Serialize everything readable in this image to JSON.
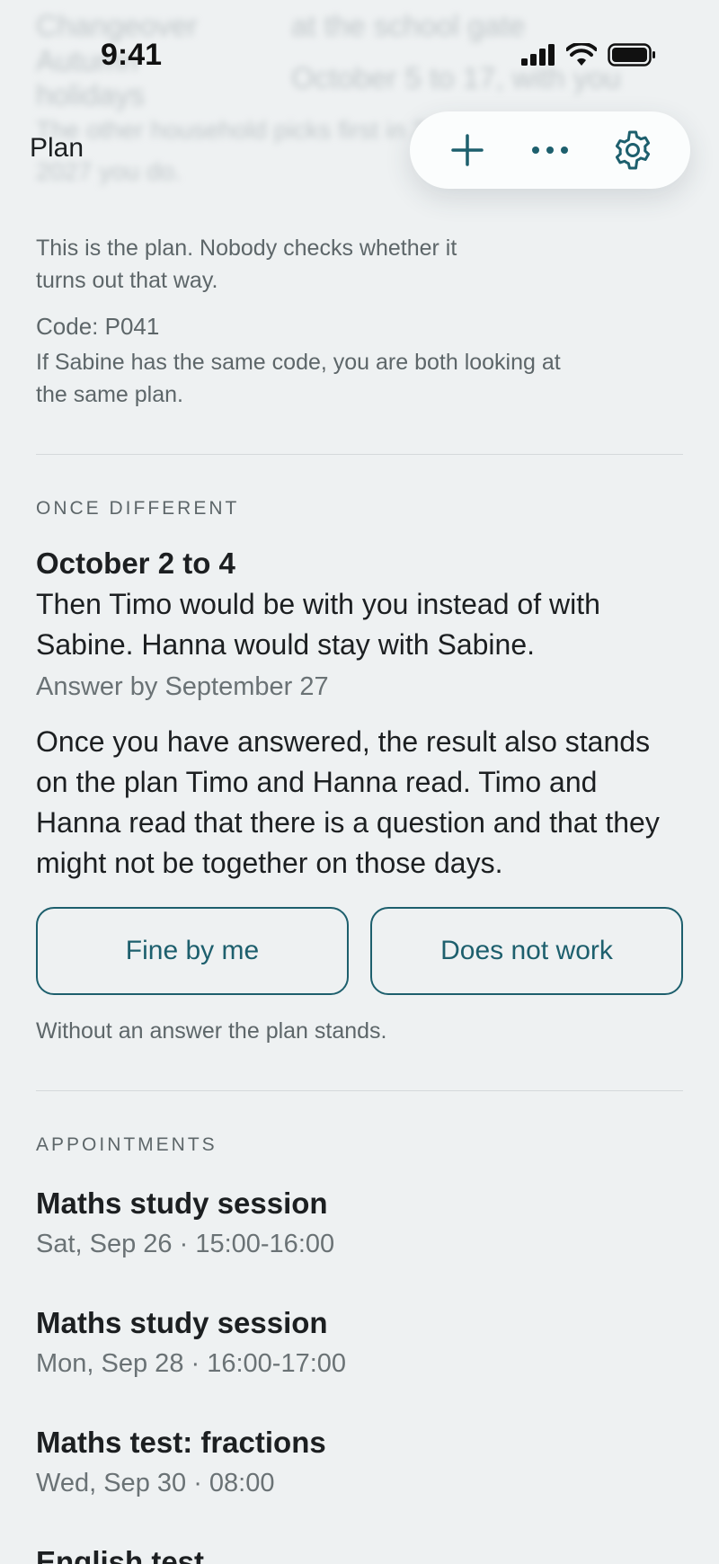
{
  "status": {
    "time": "9:41"
  },
  "background_rows": [
    {
      "label": "Changeover",
      "value": "at the school gate"
    },
    {
      "label": "Autumn holidays",
      "value": "October 5 to 17, with you"
    }
  ],
  "background_paragraph": "The other household picks first in 2026, in 2027 you do.",
  "nav": {
    "title": "Plan",
    "add_icon": "plus-icon",
    "more_icon": "more-icon",
    "settings_icon": "gear-icon"
  },
  "plan_note": {
    "text": "This is the plan. Nobody checks whether it turns out that way.",
    "code": "Code: P041",
    "code_note": "If Sabine has the same code, you are both looking at the same plan."
  },
  "once_different": {
    "label": "ONCE DIFFERENT",
    "dates": "October 2 to 4",
    "description": "Then Timo would be with you instead of with Sabine. Hanna would stay with Sabine.",
    "deadline": "Answer by September 27",
    "explanation": "Once you have answered, the result also stands on the plan Timo and Hanna read. Timo and Hanna read that there is a question and that they might not be together on those days.",
    "accept_label": "Fine by me",
    "decline_label": "Does not work",
    "footnote": "Without an answer the plan stands."
  },
  "appointments": {
    "label": "APPOINTMENTS",
    "items": [
      {
        "title": "Maths study session",
        "when": "Sat, Sep 26 · 15:00-16:00"
      },
      {
        "title": "Maths study session",
        "when": "Mon, Sep 28 · 16:00-17:00"
      },
      {
        "title": "Maths test: fractions",
        "when": "Wed, Sep 30 · 08:00"
      },
      {
        "title": "English test",
        "when": ""
      }
    ]
  },
  "colors": {
    "accent": "#1d5f6d",
    "background": "#eef1f2"
  }
}
